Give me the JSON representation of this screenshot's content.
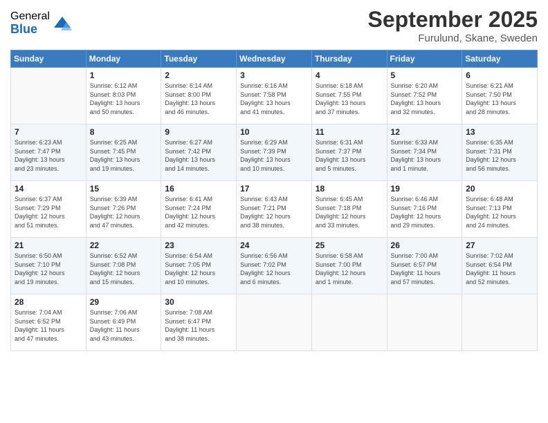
{
  "logo": {
    "general": "General",
    "blue": "Blue"
  },
  "title": "September 2025",
  "location": "Furulund, Skane, Sweden",
  "headers": [
    "Sunday",
    "Monday",
    "Tuesday",
    "Wednesday",
    "Thursday",
    "Friday",
    "Saturday"
  ],
  "weeks": [
    [
      {
        "day": "",
        "info": ""
      },
      {
        "day": "1",
        "info": "Sunrise: 6:12 AM\nSunset: 8:03 PM\nDaylight: 13 hours\nand 50 minutes."
      },
      {
        "day": "2",
        "info": "Sunrise: 6:14 AM\nSunset: 8:00 PM\nDaylight: 13 hours\nand 46 minutes."
      },
      {
        "day": "3",
        "info": "Sunrise: 6:16 AM\nSunset: 7:58 PM\nDaylight: 13 hours\nand 41 minutes."
      },
      {
        "day": "4",
        "info": "Sunrise: 6:18 AM\nSunset: 7:55 PM\nDaylight: 13 hours\nand 37 minutes."
      },
      {
        "day": "5",
        "info": "Sunrise: 6:20 AM\nSunset: 7:52 PM\nDaylight: 13 hours\nand 32 minutes."
      },
      {
        "day": "6",
        "info": "Sunrise: 6:21 AM\nSunset: 7:50 PM\nDaylight: 13 hours\nand 28 minutes."
      }
    ],
    [
      {
        "day": "7",
        "info": "Sunrise: 6:23 AM\nSunset: 7:47 PM\nDaylight: 13 hours\nand 23 minutes."
      },
      {
        "day": "8",
        "info": "Sunrise: 6:25 AM\nSunset: 7:45 PM\nDaylight: 13 hours\nand 19 minutes."
      },
      {
        "day": "9",
        "info": "Sunrise: 6:27 AM\nSunset: 7:42 PM\nDaylight: 13 hours\nand 14 minutes."
      },
      {
        "day": "10",
        "info": "Sunrise: 6:29 AM\nSunset: 7:39 PM\nDaylight: 13 hours\nand 10 minutes."
      },
      {
        "day": "11",
        "info": "Sunrise: 6:31 AM\nSunset: 7:37 PM\nDaylight: 13 hours\nand 5 minutes."
      },
      {
        "day": "12",
        "info": "Sunrise: 6:33 AM\nSunset: 7:34 PM\nDaylight: 13 hours\nand 1 minute."
      },
      {
        "day": "13",
        "info": "Sunrise: 6:35 AM\nSunset: 7:31 PM\nDaylight: 12 hours\nand 56 minutes."
      }
    ],
    [
      {
        "day": "14",
        "info": "Sunrise: 6:37 AM\nSunset: 7:29 PM\nDaylight: 12 hours\nand 51 minutes."
      },
      {
        "day": "15",
        "info": "Sunrise: 6:39 AM\nSunset: 7:26 PM\nDaylight: 12 hours\nand 47 minutes."
      },
      {
        "day": "16",
        "info": "Sunrise: 6:41 AM\nSunset: 7:24 PM\nDaylight: 12 hours\nand 42 minutes."
      },
      {
        "day": "17",
        "info": "Sunrise: 6:43 AM\nSunset: 7:21 PM\nDaylight: 12 hours\nand 38 minutes."
      },
      {
        "day": "18",
        "info": "Sunrise: 6:45 AM\nSunset: 7:18 PM\nDaylight: 12 hours\nand 33 minutes."
      },
      {
        "day": "19",
        "info": "Sunrise: 6:46 AM\nSunset: 7:16 PM\nDaylight: 12 hours\nand 29 minutes."
      },
      {
        "day": "20",
        "info": "Sunrise: 6:48 AM\nSunset: 7:13 PM\nDaylight: 12 hours\nand 24 minutes."
      }
    ],
    [
      {
        "day": "21",
        "info": "Sunrise: 6:50 AM\nSunset: 7:10 PM\nDaylight: 12 hours\nand 19 minutes."
      },
      {
        "day": "22",
        "info": "Sunrise: 6:52 AM\nSunset: 7:08 PM\nDaylight: 12 hours\nand 15 minutes."
      },
      {
        "day": "23",
        "info": "Sunrise: 6:54 AM\nSunset: 7:05 PM\nDaylight: 12 hours\nand 10 minutes."
      },
      {
        "day": "24",
        "info": "Sunrise: 6:56 AM\nSunset: 7:02 PM\nDaylight: 12 hours\nand 6 minutes."
      },
      {
        "day": "25",
        "info": "Sunrise: 6:58 AM\nSunset: 7:00 PM\nDaylight: 12 hours\nand 1 minute."
      },
      {
        "day": "26",
        "info": "Sunrise: 7:00 AM\nSunset: 6:57 PM\nDaylight: 11 hours\nand 57 minutes."
      },
      {
        "day": "27",
        "info": "Sunrise: 7:02 AM\nSunset: 6:54 PM\nDaylight: 11 hours\nand 52 minutes."
      }
    ],
    [
      {
        "day": "28",
        "info": "Sunrise: 7:04 AM\nSunset: 6:52 PM\nDaylight: 11 hours\nand 47 minutes."
      },
      {
        "day": "29",
        "info": "Sunrise: 7:06 AM\nSunset: 6:49 PM\nDaylight: 11 hours\nand 43 minutes."
      },
      {
        "day": "30",
        "info": "Sunrise: 7:08 AM\nSunset: 6:47 PM\nDaylight: 11 hours\nand 38 minutes."
      },
      {
        "day": "",
        "info": ""
      },
      {
        "day": "",
        "info": ""
      },
      {
        "day": "",
        "info": ""
      },
      {
        "day": "",
        "info": ""
      }
    ]
  ]
}
